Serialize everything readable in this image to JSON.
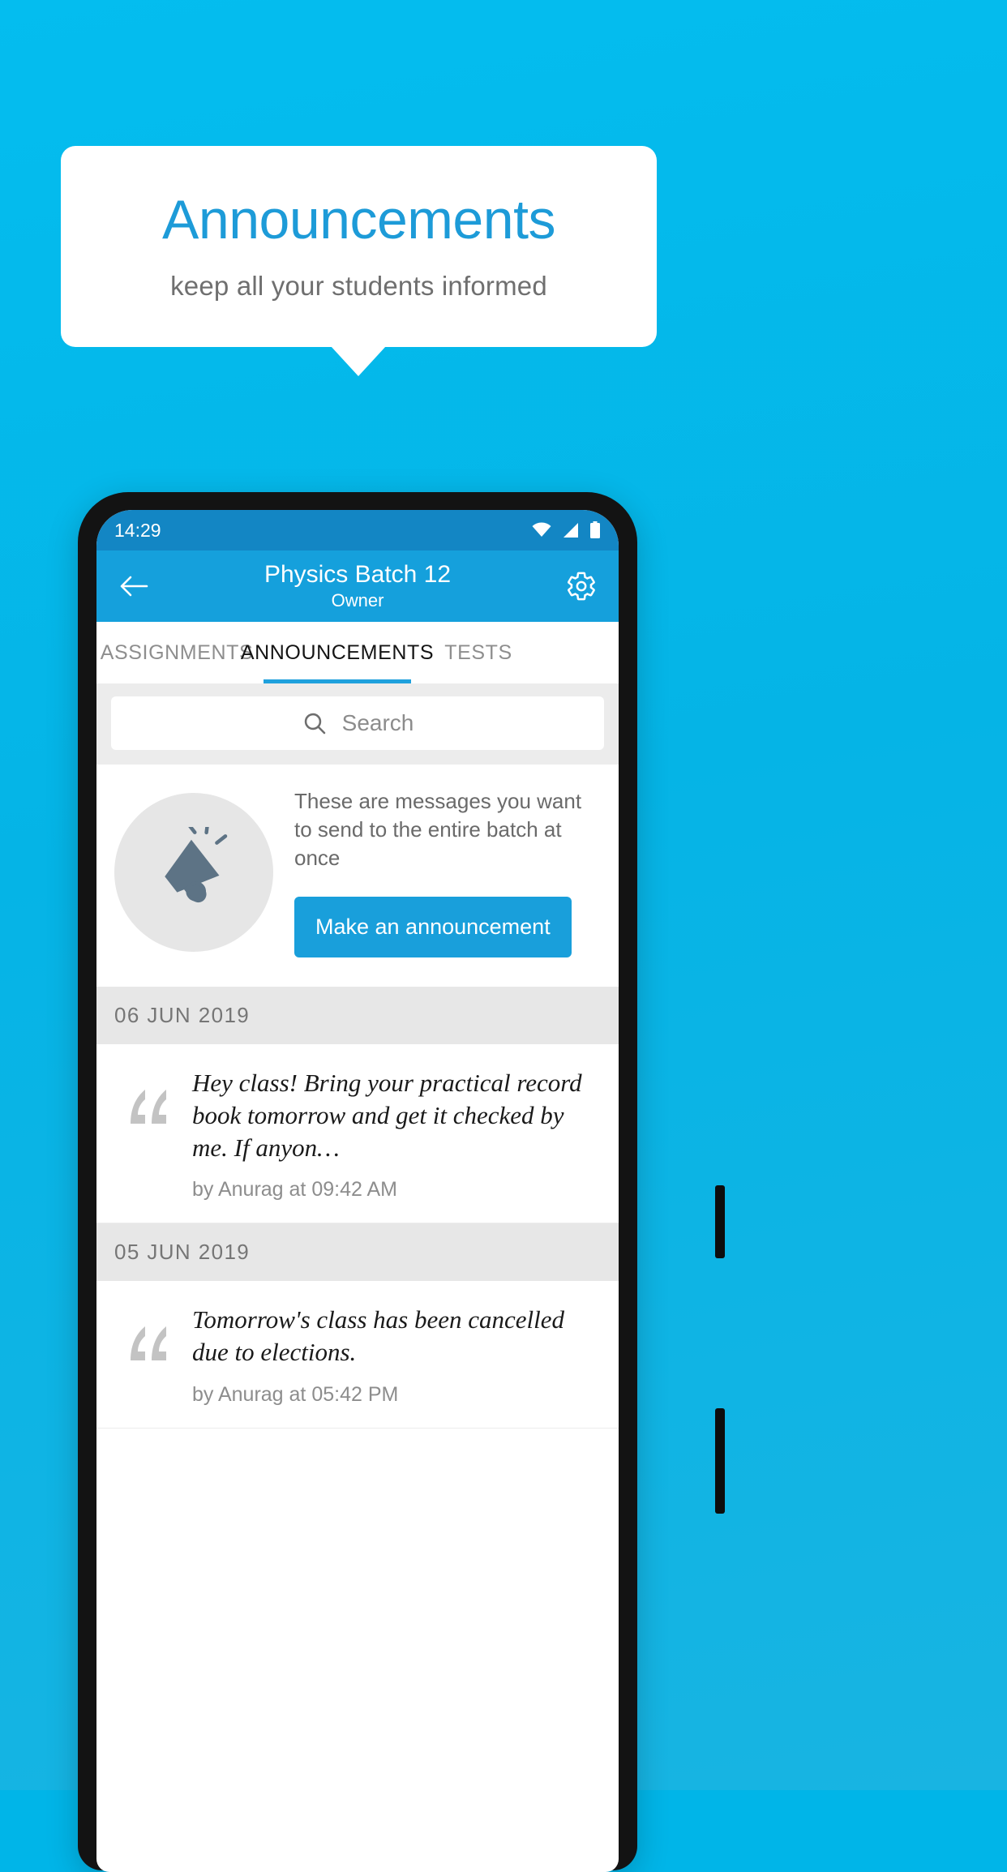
{
  "promo": {
    "headline": "Announcements",
    "subhead": "keep all your students informed",
    "headline_color": "#1d9bd8",
    "subhead_color": "#6f6f6f",
    "background_color": "#04bdef"
  },
  "statusbar": {
    "time": "14:29",
    "icons": [
      "wifi-icon",
      "signal-icon",
      "battery-icon"
    ]
  },
  "appbar": {
    "back_icon": "back-arrow-icon",
    "title": "Physics Batch 12",
    "subtitle": "Owner",
    "settings_icon": "gear-icon",
    "background_color": "#15a0dc"
  },
  "tabs": {
    "items": [
      {
        "label": "ASSIGNMENTS",
        "active": false
      },
      {
        "label": "ANNOUNCEMENTS",
        "active": true
      },
      {
        "label": "TESTS",
        "active": false
      },
      {
        "label": "\u0001",
        "active": false
      }
    ],
    "peek_label": "",
    "indicator_color": "#1fa1dd"
  },
  "search": {
    "placeholder": "Search",
    "value": "",
    "icon": "search-icon"
  },
  "empty_state": {
    "icon": "megaphone-icon",
    "description": "These are messages you want to send to the entire batch at once",
    "button_label": "Make an announcement",
    "button_color": "#199fdb"
  },
  "groups": [
    {
      "date": "06  JUN  2019",
      "items": [
        {
          "text": "Hey class! Bring your practical record book tomorrow and get it checked by me. If anyon…",
          "meta": "by Anurag at 09:42 AM",
          "quote_icon": "quote-icon"
        }
      ]
    },
    {
      "date": "05  JUN  2019",
      "items": [
        {
          "text": "Tomorrow's class has been cancelled due to elections.",
          "meta": "by Anurag at 05:42 PM",
          "quote_icon": "quote-icon"
        }
      ]
    }
  ]
}
